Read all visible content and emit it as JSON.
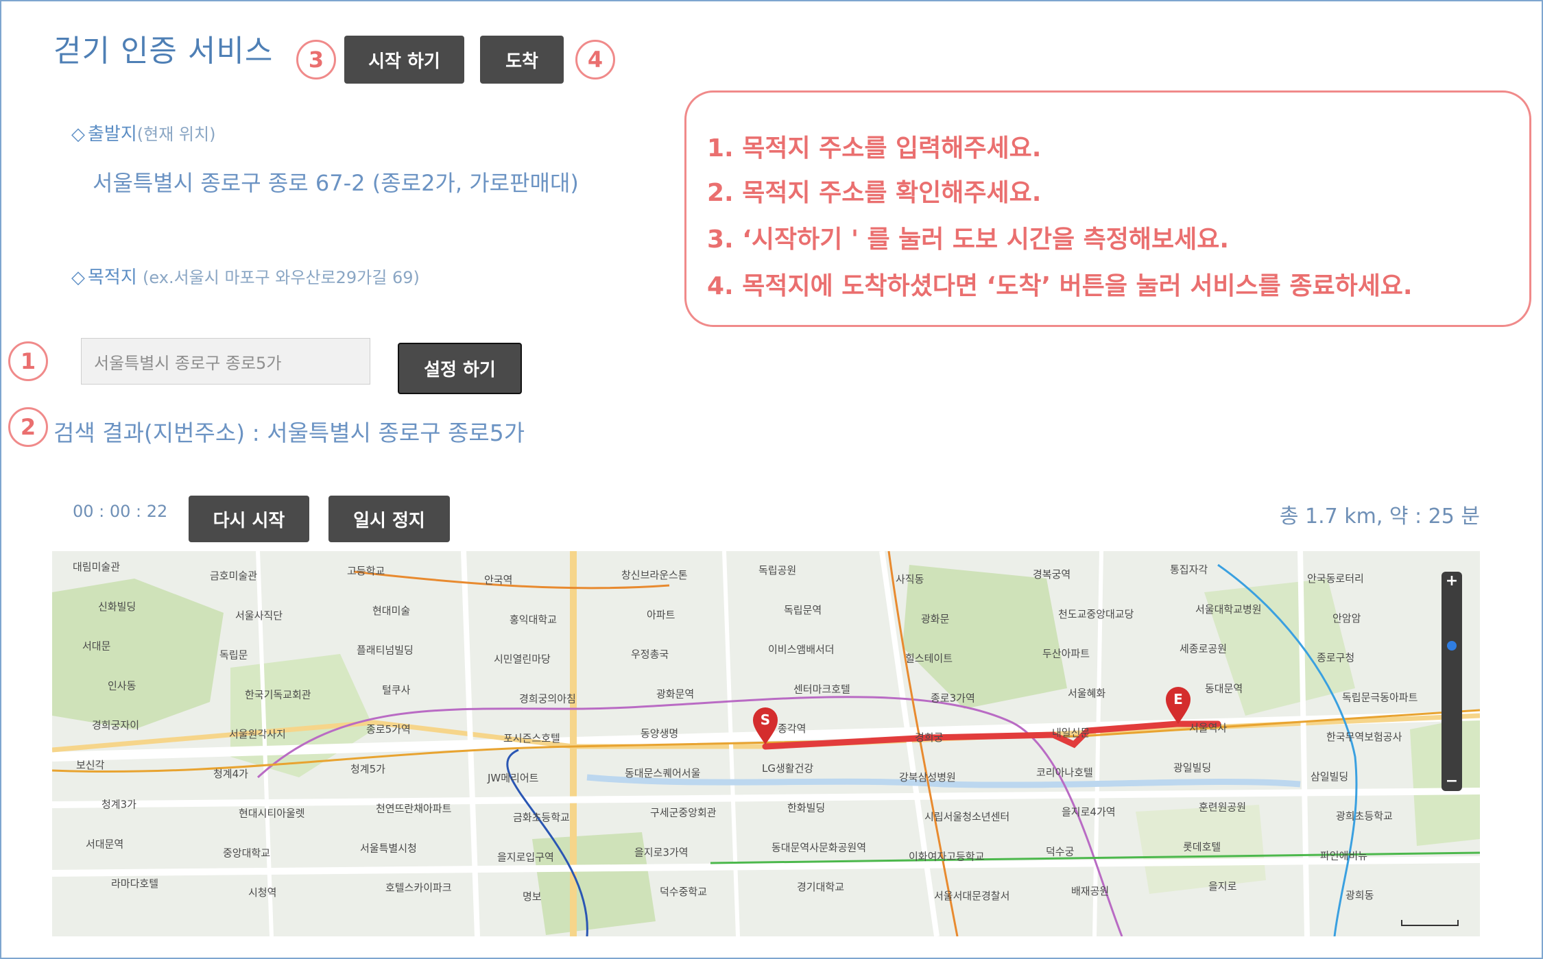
{
  "header": {
    "title": "걷기 인증 서비스",
    "step3": "3",
    "step4": "4",
    "start_label": "시작 하기",
    "arrive_label": "도착"
  },
  "origin": {
    "label": "출발지",
    "hint": "(현재 위치)",
    "address": "서울특별시 종로구 종로 67-2 (종로2가, 가로판매대)"
  },
  "destination": {
    "label": "목적지",
    "hint": "(ex.서울시 마포구 와우산로29가길 69)",
    "step1": "1",
    "input_value": "서울특별시 종로구 종로5가",
    "set_label": "설정 하기"
  },
  "result": {
    "step2": "2",
    "text": "검색 결과(지번주소) : 서울특별시 종로구 종로5가"
  },
  "instructions": [
    "1.  목적지 주소를 입력해주세요.",
    "2.  목적지 주소를 확인해주세요.",
    "3.  ‘시작하기 ' 를 눌러 도보 시간을 측정해보세요.",
    "4. 목적지에 도착하셨다면 ‘도착’ 버튼을 눌러 서비스를 종료하세요."
  ],
  "controls": {
    "timer": "00 : 00 : 22",
    "restart_label": "다시 시작",
    "pause_label": "일시 정지",
    "summary": "총 1.7 km, 약 : 25 분"
  },
  "map": {
    "start_marker": "S",
    "end_marker": "E",
    "zoom_in": "+",
    "zoom_out": "−",
    "labels": [
      "대림미술관",
      "금호미술관",
      "고등학교",
      "안국역",
      "창신브라운스톤",
      "독립공원",
      "사직동",
      "경복궁역",
      "통집자각",
      "안국동로터리",
      "신화빌딩",
      "서울사직단",
      "현대미술",
      "홍익대학교",
      "아파트",
      "독립문역",
      "광화문",
      "천도교중앙대교당",
      "서울대학교병원",
      "안암암",
      "서대문",
      "독립문",
      "플래티넘빌딩",
      "시민열린마당",
      "우정총국",
      "이비스앰배서더",
      "힐스테이트",
      "두산아파트",
      "세종로공원",
      "종로구청",
      "인사동",
      "한국기독교회관",
      "털쿠사",
      "경희궁의아침",
      "광화문역",
      "센터마크호텔",
      "종로3가역",
      "서울혜화",
      "동대문역",
      "독립문극동아파트",
      "경희궁자이",
      "서울원각사지",
      "종로5가역",
      "포시즌스호텔",
      "동양생명",
      "종각역",
      "경희궁",
      "내일신문",
      "서울역사",
      "한국무역보험공사",
      "보신각",
      "청계4가",
      "청계5가",
      "JW메리어트",
      "동대문스퀘어서울",
      "LG생활건강",
      "강북삼성병원",
      "코리아나호텔",
      "광일빌딩",
      "삼일빌딩",
      "청계3가",
      "현대시티아울렛",
      "천연뜨란채아파트",
      "금화초등학교",
      "구세군중앙회관",
      "한화빌딩",
      "시립서울청소년센터",
      "을지로4가역",
      "훈련원공원",
      "광희초등학교",
      "서대문역",
      "중앙대학교",
      "서울특별시청",
      "을지로입구역",
      "을지로3가역",
      "동대문역사문화공원역",
      "이화여자고등학교",
      "덕수궁",
      "롯데호텔",
      "파인애비뉴",
      "라마다호텔",
      "시청역",
      "호텔스카이파크",
      "명보",
      "덕수중학교",
      "경기대학교",
      "서울서대문경찰서",
      "배재공원",
      "을지로",
      "광희동"
    ]
  }
}
